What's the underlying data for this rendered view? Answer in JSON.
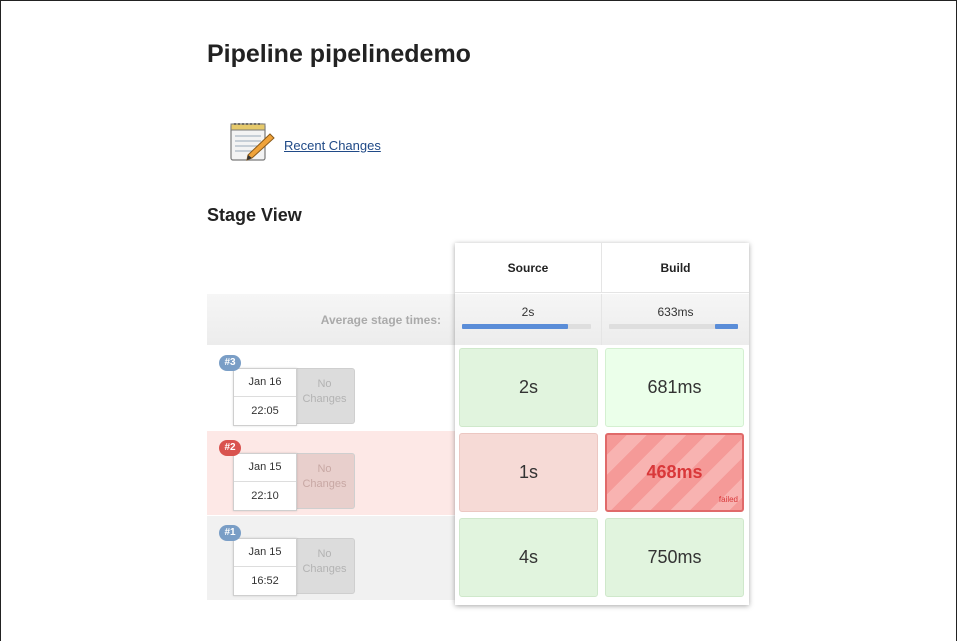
{
  "page": {
    "title": "Pipeline pipelinedemo",
    "recent_changes_label": "Recent Changes",
    "stage_view_title": "Stage View"
  },
  "stages": {
    "headers": [
      "Source",
      "Build"
    ],
    "average_label": "Average stage times:",
    "averages": [
      {
        "time": "2s",
        "progress_percent": 82
      },
      {
        "time": "633ms",
        "progress_percent": 18
      }
    ]
  },
  "builds": [
    {
      "number": "#3",
      "date": "Jan 16",
      "time": "22:05",
      "changes": [
        "No",
        "Changes"
      ],
      "status": "success",
      "stage_times": [
        "2s",
        "681ms"
      ]
    },
    {
      "number": "#2",
      "date": "Jan 15",
      "time": "22:10",
      "changes": [
        "No",
        "Changes"
      ],
      "status": "failed",
      "stage_times": [
        "1s",
        "468ms"
      ],
      "failed_label": "failed"
    },
    {
      "number": "#1",
      "date": "Jan 15",
      "time": "16:52",
      "changes": [
        "No",
        "Changes"
      ],
      "status": "success",
      "stage_times": [
        "4s",
        "750ms"
      ]
    }
  ],
  "colors": {
    "success_cell": "#e1f4de",
    "failed_cell": "#f59a98",
    "failed_badge": "#d9534f",
    "success_badge": "#7a9ec6",
    "progress_bar": "#5a8dd8",
    "link": "#204a87"
  },
  "icons": {
    "recent_changes": "notepad-pencil-icon"
  }
}
